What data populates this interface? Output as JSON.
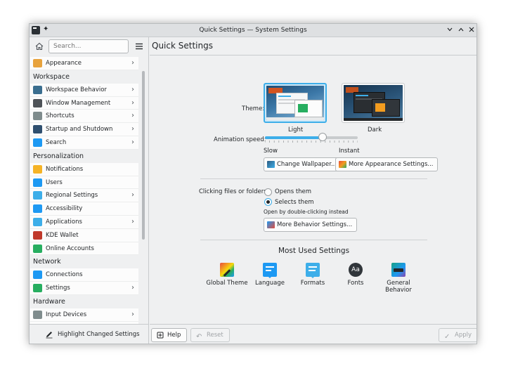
{
  "window": {
    "title": "Quick Settings — System Settings"
  },
  "sidebar": {
    "search_placeholder": "Search...",
    "items": [
      {
        "type": "item",
        "label": "Appearance",
        "chevron": true,
        "icon": "appearance-icon",
        "color": "#e8a33d"
      },
      {
        "type": "category",
        "label": "Workspace"
      },
      {
        "type": "item",
        "label": "Workspace Behavior",
        "chevron": true,
        "icon": "workspace-behavior-icon",
        "color": "#3a6e8f"
      },
      {
        "type": "item",
        "label": "Window Management",
        "chevron": true,
        "icon": "window-management-icon",
        "color": "#4d5257"
      },
      {
        "type": "item",
        "label": "Shortcuts",
        "chevron": true,
        "icon": "keyboard-icon",
        "color": "#7f8c8d"
      },
      {
        "type": "item",
        "label": "Startup and Shutdown",
        "chevron": true,
        "icon": "startup-icon",
        "color": "#2f4f6f"
      },
      {
        "type": "item",
        "label": "Search",
        "chevron": true,
        "icon": "search-settings-icon",
        "color": "#1d99f3"
      },
      {
        "type": "category",
        "label": "Personalization"
      },
      {
        "type": "item",
        "label": "Notifications",
        "chevron": false,
        "icon": "bell-icon",
        "color": "#f5b326"
      },
      {
        "type": "item",
        "label": "Users",
        "chevron": false,
        "icon": "users-icon",
        "color": "#1d99f3"
      },
      {
        "type": "item",
        "label": "Regional Settings",
        "chevron": true,
        "icon": "regional-icon",
        "color": "#3daee9"
      },
      {
        "type": "item",
        "label": "Accessibility",
        "chevron": false,
        "icon": "accessibility-icon",
        "color": "#1d99f3"
      },
      {
        "type": "item",
        "label": "Applications",
        "chevron": true,
        "icon": "applications-icon",
        "color": "#3daee9"
      },
      {
        "type": "item",
        "label": "KDE Wallet",
        "chevron": false,
        "icon": "wallet-icon",
        "color": "#c0392b"
      },
      {
        "type": "item",
        "label": "Online Accounts",
        "chevron": false,
        "icon": "online-accounts-icon",
        "color": "#27ae60"
      },
      {
        "type": "category",
        "label": "Network"
      },
      {
        "type": "item",
        "label": "Connections",
        "chevron": false,
        "icon": "connections-icon",
        "color": "#1d99f3"
      },
      {
        "type": "item",
        "label": "Settings",
        "chevron": true,
        "icon": "network-settings-icon",
        "color": "#27ae60"
      },
      {
        "type": "category",
        "label": "Hardware"
      },
      {
        "type": "item",
        "label": "Input Devices",
        "chevron": true,
        "icon": "mouse-icon",
        "color": "#7f8c8d"
      }
    ],
    "highlight_label": "Highlight Changed Settings"
  },
  "main": {
    "title": "Quick Settings",
    "theme_label": "Theme:",
    "themes": [
      {
        "name": "Light",
        "selected": true
      },
      {
        "name": "Dark",
        "selected": false
      }
    ],
    "animation_label": "Animation speed:",
    "animation_level": 0.62,
    "slow_label": "Slow",
    "instant_label": "Instant",
    "change_wallpaper_label": "Change Wallpaper...",
    "more_appearance_label": "More Appearance Settings...",
    "clicking_label": "Clicking files or folders:",
    "opens_label": "Opens them",
    "selects_label": "Selects them",
    "selected_option": "selects",
    "hint_label": "Open by double-clicking instead",
    "more_behavior_label": "More Behavior Settings...",
    "most_used_title": "Most Used Settings",
    "most_used": [
      {
        "label": "Global Theme",
        "icon": "global-theme-icon"
      },
      {
        "label": "Language",
        "icon": "language-icon"
      },
      {
        "label": "Formats",
        "icon": "formats-icon"
      },
      {
        "label": "Fonts",
        "icon": "fonts-icon",
        "glyph": "Aa"
      },
      {
        "label": "General Behavior",
        "icon": "general-behavior-icon"
      }
    ]
  },
  "footer": {
    "help_label": "Help",
    "reset_label": "Reset",
    "apply_label": "Apply"
  },
  "colors": {
    "accent": "#3daee9",
    "window_bg": "#eff0f1",
    "view_bg": "#fcfcfc"
  }
}
